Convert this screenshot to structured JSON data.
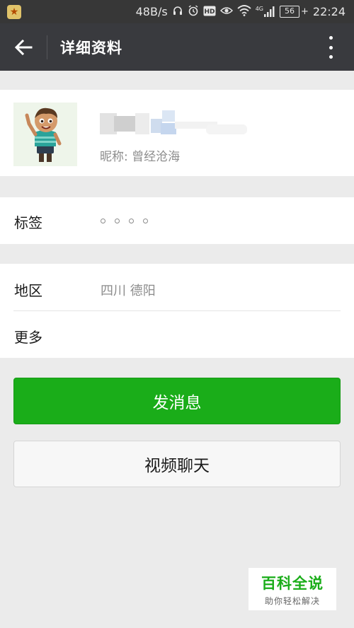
{
  "status_bar": {
    "network_speed": "48B/s",
    "network_type": "4G",
    "battery": "56",
    "time": "22:24",
    "icons": [
      "app-notification-icon",
      "headphones-icon",
      "alarm-icon",
      "hd-icon",
      "eye-icon",
      "wifi-icon",
      "signal-icon",
      "battery-icon"
    ]
  },
  "header": {
    "title": "详细资料",
    "back_icon": "arrow-left-icon",
    "more_icon": "more-vertical-icon",
    "background": "#393a3e"
  },
  "profile": {
    "nickname": "昵称: 曾经沧海",
    "name_blurred": true
  },
  "tags": {
    "label": "标签",
    "value": "。。。。"
  },
  "info": {
    "region_label": "地区",
    "region_value": "四川  德阳",
    "more_label": "更多"
  },
  "actions": {
    "send_message": "发消息",
    "video_chat": "视频聊天",
    "primary_color": "#1aad19"
  },
  "watermark": {
    "title": "百科全说",
    "subtitle": "助你轻松解决"
  }
}
